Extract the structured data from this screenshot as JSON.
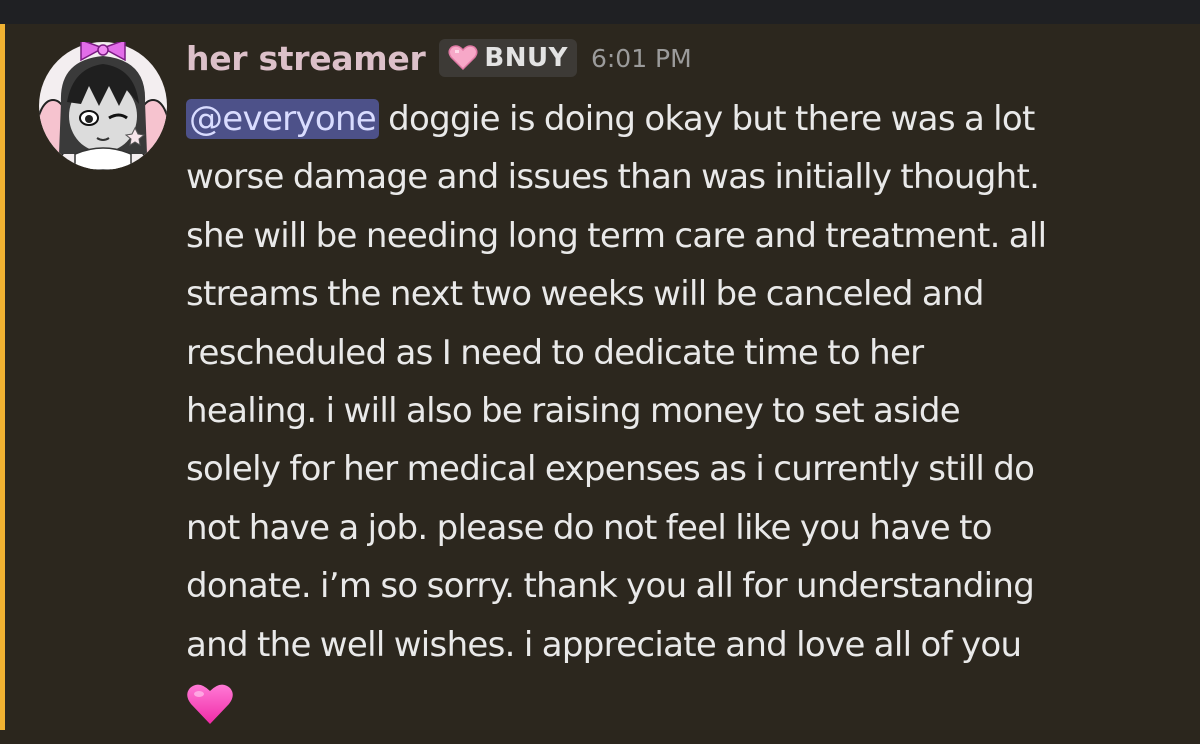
{
  "message": {
    "author": "her streamer",
    "role_tag": "BNUY",
    "role_icon": "pink-heart-icon",
    "timestamp": "6:01 PM",
    "mention": "@everyone",
    "lines": [
      " doggie is doing okay but there was a lot",
      "worse damage and issues than was initially thought.",
      "she will be needing long term care and treatment. all",
      "streams the next two weeks will be canceled and",
      "rescheduled as I need to dedicate time to her",
      "healing. i will also be raising money to set aside",
      "solely for her medical expenses as i currently still do",
      "not have a job. please do not feel like you have to",
      "donate. i’m so sorry. thank you all for understanding",
      "and the well wishes. i appreciate and love all of you"
    ],
    "trailing_emoji": "pink-heart-emoji"
  },
  "colors": {
    "background": "#2c271e",
    "highlight_stripe": "#f0b232",
    "username": "#dcc0c9",
    "mention_bg": "#4d5189",
    "text": "#e9e9e9",
    "heart": "#ff4fc4"
  }
}
